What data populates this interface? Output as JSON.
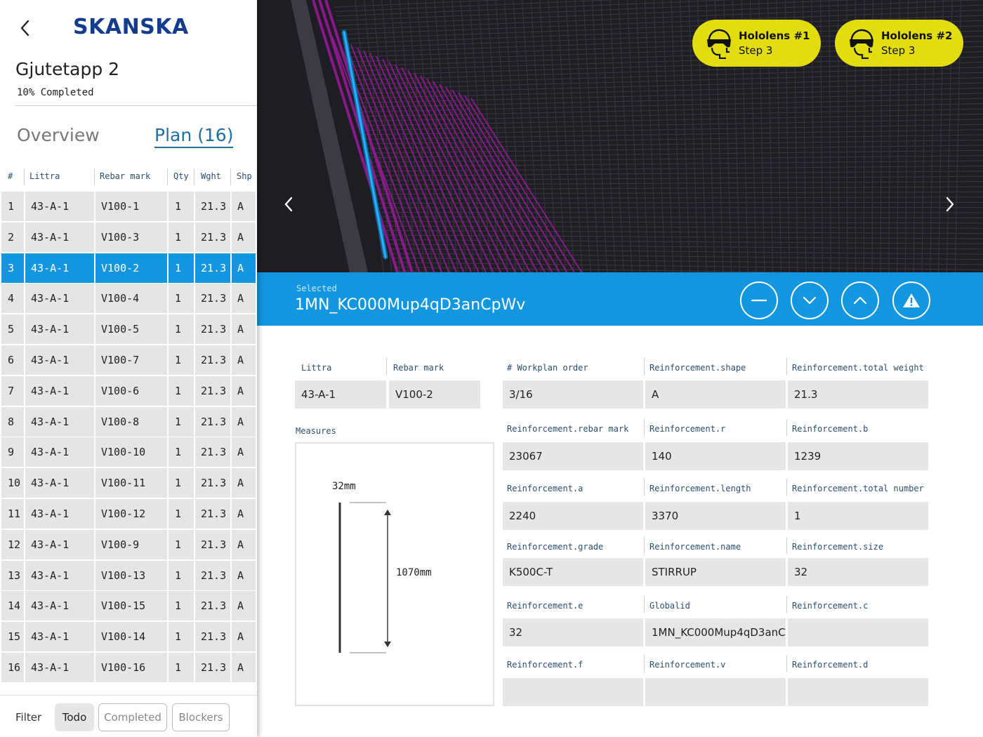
{
  "sidebar": {
    "logo": "SKANSKA",
    "project_title": "Gjutetapp 2",
    "project_status": "10% Completed",
    "tabs": {
      "overview": "Overview",
      "plan": "Plan (16)"
    },
    "columns": [
      "#",
      "Littra",
      "Rebar mark",
      "Qty",
      "Wght",
      "Shp"
    ],
    "rows": [
      {
        "num": "1",
        "littra": "43-A-1",
        "rebar": "V100-1",
        "qty": "1",
        "wght": "21.3",
        "shp": "A"
      },
      {
        "num": "2",
        "littra": "43-A-1",
        "rebar": "V100-3",
        "qty": "1",
        "wght": "21.3",
        "shp": "A"
      },
      {
        "num": "3",
        "littra": "43-A-1",
        "rebar": "V100-2",
        "qty": "1",
        "wght": "21.3",
        "shp": "A"
      },
      {
        "num": "4",
        "littra": "43-A-1",
        "rebar": "V100-4",
        "qty": "1",
        "wght": "21.3",
        "shp": "A"
      },
      {
        "num": "5",
        "littra": "43-A-1",
        "rebar": "V100-5",
        "qty": "1",
        "wght": "21.3",
        "shp": "A"
      },
      {
        "num": "6",
        "littra": "43-A-1",
        "rebar": "V100-7",
        "qty": "1",
        "wght": "21.3",
        "shp": "A"
      },
      {
        "num": "7",
        "littra": "43-A-1",
        "rebar": "V100-6",
        "qty": "1",
        "wght": "21.3",
        "shp": "A"
      },
      {
        "num": "8",
        "littra": "43-A-1",
        "rebar": "V100-8",
        "qty": "1",
        "wght": "21.3",
        "shp": "A"
      },
      {
        "num": "9",
        "littra": "43-A-1",
        "rebar": "V100-10",
        "qty": "1",
        "wght": "21.3",
        "shp": "A"
      },
      {
        "num": "10",
        "littra": "43-A-1",
        "rebar": "V100-11",
        "qty": "1",
        "wght": "21.3",
        "shp": "A"
      },
      {
        "num": "11",
        "littra": "43-A-1",
        "rebar": "V100-12",
        "qty": "1",
        "wght": "21.3",
        "shp": "A"
      },
      {
        "num": "12",
        "littra": "43-A-1",
        "rebar": "V100-9",
        "qty": "1",
        "wght": "21.3",
        "shp": "A"
      },
      {
        "num": "13",
        "littra": "43-A-1",
        "rebar": "V100-13",
        "qty": "1",
        "wght": "21.3",
        "shp": "A"
      },
      {
        "num": "14",
        "littra": "43-A-1",
        "rebar": "V100-15",
        "qty": "1",
        "wght": "21.3",
        "shp": "A"
      },
      {
        "num": "15",
        "littra": "43-A-1",
        "rebar": "V100-14",
        "qty": "1",
        "wght": "21.3",
        "shp": "A"
      },
      {
        "num": "16",
        "littra": "43-A-1",
        "rebar": "V100-16",
        "qty": "1",
        "wght": "21.3",
        "shp": "A"
      }
    ],
    "selected_row": "3",
    "filter": {
      "label": "Filter",
      "todo": "Todo",
      "completed": "Completed",
      "blockers": "Blockers",
      "active": "Todo"
    }
  },
  "viewer": {
    "devices": [
      {
        "name": "Hololens #1",
        "step": "Step 3",
        "icon": "headset-icon"
      },
      {
        "name": "Hololens #2",
        "step": "Step 3",
        "icon": "headset-icon"
      }
    ],
    "colors": {
      "background": "#1e1d24",
      "highlight_rebar": "#2bb0ff",
      "rebar": "#8a1a8c",
      "device_badge": "#e3dd0f"
    }
  },
  "selected": {
    "label": "Selected",
    "id": "1MN_KC000Mup4qD3anCpWv",
    "actions": [
      "minus-icon",
      "chevron-down-icon",
      "chevron-up-icon",
      "warning-icon"
    ],
    "color": "#1296e0"
  },
  "details": {
    "littra": {
      "label": "Littra",
      "value": "43-A-1"
    },
    "rebar_mark": {
      "label": "Rebar mark",
      "value": "V100-2"
    },
    "measures_label": "Measures",
    "measure_width": "32mm",
    "measure_length": "1070mm",
    "fields": [
      {
        "label": "# Workplan order",
        "value": "3/16"
      },
      {
        "label": "Reinforcement.shape",
        "value": "A"
      },
      {
        "label": "Reinforcement.total weight",
        "value": "21.3"
      },
      {
        "label": "Reinforcement.rebar mark",
        "value": "23067"
      },
      {
        "label": "Reinforcement.r",
        "value": "140"
      },
      {
        "label": "Reinforcement.b",
        "value": "1239"
      },
      {
        "label": "Reinforcement.a",
        "value": "2240"
      },
      {
        "label": "Reinforcement.length",
        "value": "3370"
      },
      {
        "label": "Reinforcement.total number",
        "value": "1"
      },
      {
        "label": "Reinforcement.grade",
        "value": "K500C-T"
      },
      {
        "label": "Reinforcement.name",
        "value": "STIRRUP"
      },
      {
        "label": "Reinforcement.size",
        "value": "32"
      },
      {
        "label": "Reinforcement.e",
        "value": "32"
      },
      {
        "label": "Globalid",
        "value": "1MN_KC000Mup4qD3anC.."
      },
      {
        "label": "Reinforcement.c",
        "value": ""
      },
      {
        "label": "Reinforcement.f",
        "value": ""
      },
      {
        "label": "Reinforcement.v",
        "value": ""
      },
      {
        "label": "Reinforcement.d",
        "value": ""
      }
    ]
  }
}
